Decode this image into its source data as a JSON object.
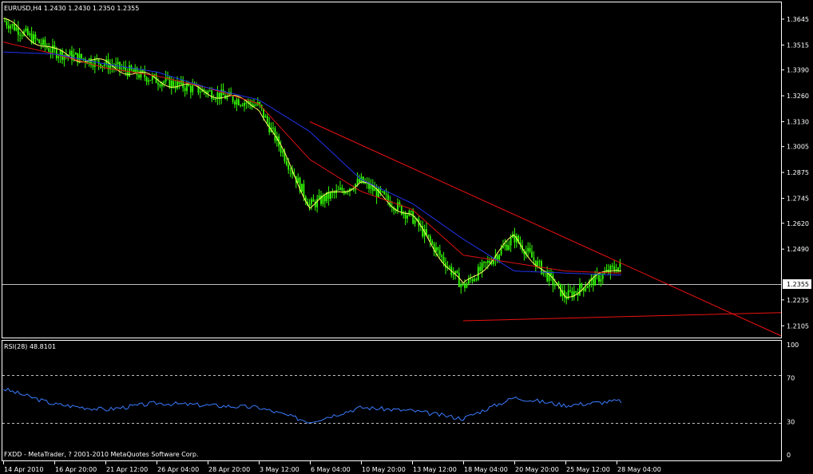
{
  "colors": {
    "background": "#000000",
    "frame": "#ffffff",
    "candle": "#33ff00",
    "ma_slow": "#2233ee",
    "ma_fast": "#dd1111",
    "ma_short": "#ffff66",
    "trendline": "#ee1111",
    "price_line": "#c0c0c0",
    "rsi_line": "#3a7bff",
    "rsi_levels": "#c0c0c0",
    "current_price_bg": "#ffffff",
    "current_price_text": "#000000"
  },
  "main_panel": {
    "title": "EURUSD,H4  1.2430 1.2430 1.2350 1.2355",
    "y_ticks": [
      "1.3645",
      "1.3515",
      "1.3390",
      "1.3260",
      "1.3130",
      "1.3005",
      "1.2875",
      "1.2745",
      "1.2620",
      "1.2490",
      "1.2355",
      "1.2235",
      "1.2105"
    ],
    "current_price": "1.2355"
  },
  "rsi_panel": {
    "title": "RSI(28) 48.8101",
    "y_ticks": [
      "100",
      "70",
      "30",
      "0"
    ],
    "footer": "FXDD - MetaTrader, ? 2001-2010 MetaQuotes Software Corp."
  },
  "x_ticks": [
    "14 Apr 2010",
    "16 Apr 20:00",
    "21 Apr 12:00",
    "26 Apr 04:00",
    "28 Apr 20:00",
    "3 May 12:00",
    "6 May 04:00",
    "10 May 20:00",
    "13 May 12:00",
    "18 May 04:00",
    "20 May 20:00",
    "25 May 12:00",
    "28 May 04:00"
  ],
  "chart_data": [
    {
      "type": "line",
      "symbol": "EURUSD",
      "timeframe": "H4",
      "last_bar": {
        "open": 1.243,
        "high": 1.243,
        "low": 1.235,
        "close": 1.2355
      },
      "y_range": [
        1.205,
        1.3725
      ],
      "x": [
        "14 Apr 2010",
        "16 Apr 20:00",
        "21 Apr 12:00",
        "26 Apr 04:00",
        "28 Apr 20:00",
        "3 May 12:00",
        "6 May 04:00",
        "10 May 20:00",
        "13 May 12:00",
        "18 May 04:00",
        "20 May 20:00",
        "25 May 12:00",
        "28 May 04:00"
      ],
      "series": [
        {
          "values": [
            1.364,
            1.348,
            1.342,
            1.334,
            1.328,
            1.321,
            1.271,
            1.283,
            1.265,
            1.23,
            1.255,
            1.225,
            1.24
          ]
        },
        {
          "values": [
            1.353,
            1.347,
            1.34,
            1.336,
            1.33,
            1.322,
            1.294,
            1.278,
            1.269,
            1.246,
            1.242,
            1.238,
            1.237
          ]
        },
        {
          "values": [
            1.348,
            1.347,
            1.342,
            1.338,
            1.33,
            1.324,
            1.308,
            1.284,
            1.272,
            1.254,
            1.238,
            1.237,
            1.236
          ]
        }
      ],
      "trendlines": [
        {
          "from": {
            "x": "6 May 04:00",
            "y": 1.313
          },
          "to": {
            "x": "28 May 04:00",
            "y": 1.243
          }
        },
        {
          "from": {
            "x": "18 May 04:00",
            "y": 1.213
          },
          "to": {
            "x": "28 May 04:00",
            "y": 1.215
          }
        }
      ]
    },
    {
      "type": "line",
      "title": "RSI(28) 48.8101",
      "y_range": [
        0,
        100
      ],
      "levels": [
        70,
        30
      ],
      "x": [
        "14 Apr 2010",
        "16 Apr 20:00",
        "21 Apr 12:00",
        "26 Apr 04:00",
        "28 Apr 20:00",
        "3 May 12:00",
        "6 May 04:00",
        "10 May 20:00",
        "13 May 12:00",
        "18 May 04:00",
        "20 May 20:00",
        "25 May 12:00",
        "28 May 04:00"
      ],
      "series": [
        {
          "values": [
            60,
            46,
            41,
            47,
            45,
            43,
            30,
            43,
            40,
            33,
            52,
            45,
            48.8
          ]
        }
      ]
    }
  ]
}
